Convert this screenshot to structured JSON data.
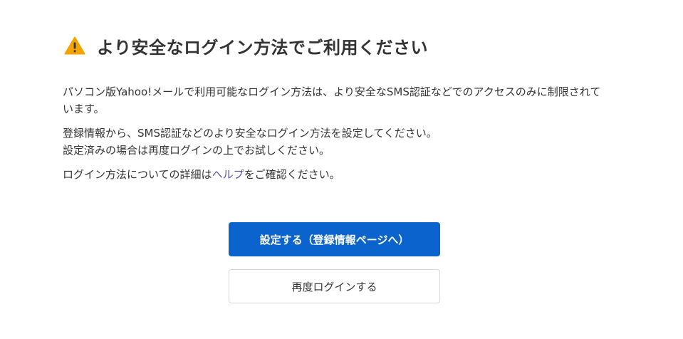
{
  "header": {
    "icon": "warning-icon",
    "warning_color": "#f5a300",
    "title": "より安全なログイン方法でご利用ください"
  },
  "body": {
    "paragraph1": "パソコン版Yahoo!メールで利用可能なログイン方法は、より安全なSMS認証などでのアクセスのみに制限されています。",
    "paragraph2_line1": "登録情報から、SMS認証などのより安全なログイン方法を設定してください。",
    "paragraph2_line2": "設定済みの場合は再度ログインの上でお試しください。",
    "paragraph3_before": "ログイン方法についての詳細は",
    "paragraph3_link": "ヘルプ",
    "paragraph3_after": "をご確認ください。"
  },
  "buttons": {
    "primary_label": "設定する（登録情報ページへ）",
    "primary_color": "#0b63ce",
    "secondary_label": "再度ログインする"
  }
}
